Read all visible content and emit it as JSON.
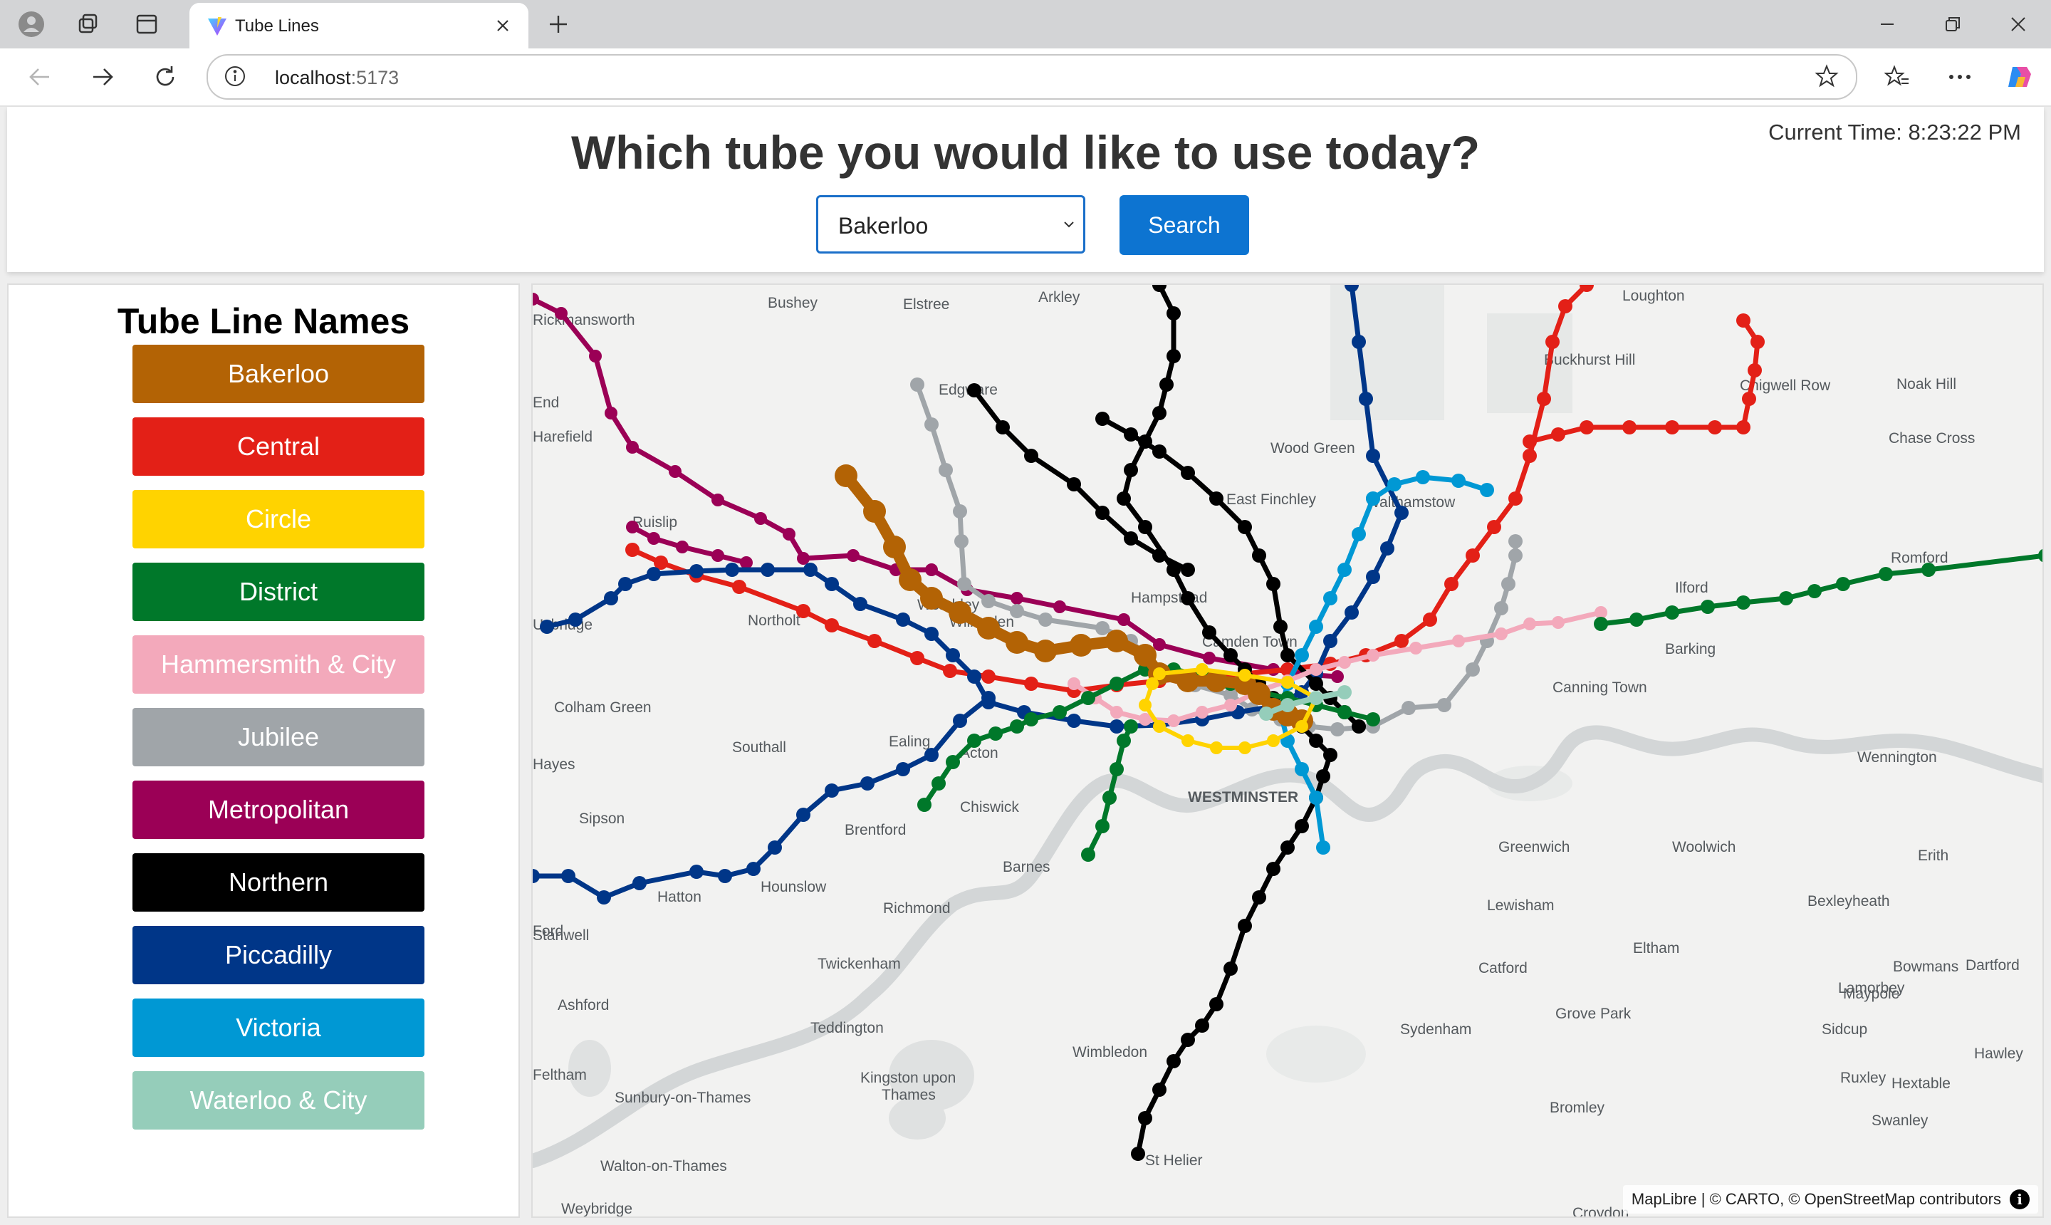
{
  "browser": {
    "tab_title": "Tube Lines",
    "url_host": "localhost",
    "url_port": ":5173"
  },
  "header": {
    "title": "Which tube you would like to use today?",
    "current_time": "Current Time: 8:23:22 PM",
    "select_value": "Bakerloo",
    "search_label": "Search"
  },
  "sidebar": {
    "title": "Tube Line Names",
    "lines": [
      {
        "name": "Bakerloo",
        "color": "#B36305"
      },
      {
        "name": "Central",
        "color": "#E32017"
      },
      {
        "name": "Circle",
        "color": "#FFD300"
      },
      {
        "name": "District",
        "color": "#00782A"
      },
      {
        "name": "Hammersmith & City",
        "color": "#F3A9BB"
      },
      {
        "name": "Jubilee",
        "color": "#A0A5A9"
      },
      {
        "name": "Metropolitan",
        "color": "#9B0056"
      },
      {
        "name": "Northern",
        "color": "#000000"
      },
      {
        "name": "Piccadilly",
        "color": "#003688"
      },
      {
        "name": "Victoria",
        "color": "#0098D4"
      },
      {
        "name": "Waterloo & City",
        "color": "#95CDBA"
      }
    ]
  },
  "map": {
    "places": [
      "Bushey",
      "Elstree",
      "Arkley",
      "Loughton",
      "Rickmansworth",
      "Edgware",
      "Buckhurst Hill",
      "Chigwell Row",
      "Noak Hill",
      "End",
      "Harefield",
      "Wood Green",
      "Chase Cross",
      "East Finchley",
      "Walthamstow",
      "Ruislip",
      "Romford",
      "Wembley",
      "Hampstead",
      "Ilford",
      "Northolt",
      "Willesden",
      "Camden Town",
      "Uxbridge",
      "Barking",
      "Colham Green",
      "Canning Town",
      "Southall",
      "Ealing",
      "Acton",
      "Wennington",
      "Hayes",
      "WESTMINSTER",
      "Sipson",
      "Chiswick",
      "Brentford",
      "Greenwich",
      "Woolwich",
      "Erith",
      "Barnes",
      "Hounslow",
      "Hatton",
      "Ford",
      "Richmond",
      "Lewisham",
      "Bexleyheath",
      "Stanwell",
      "Twickenham",
      "Eltham",
      "Bowmans",
      "Dartford",
      "Lamorbey",
      "Maypole",
      "Catford",
      "Ashford",
      "Grove Park",
      "Teddington",
      "Sydenham",
      "Sidcup",
      "Wimbledon",
      "Hawley",
      "Ruxley",
      "Hextable",
      "Kingston upon",
      "Thames",
      "Bromley",
      "Feltham",
      "Sunbury-on-Thames",
      "Swanley",
      "Walton-on-Thames",
      "St Helier",
      "Weybridge",
      "Croydon"
    ],
    "attribution": "MapLibre | © CARTO, © OpenStreetMap contributors"
  }
}
